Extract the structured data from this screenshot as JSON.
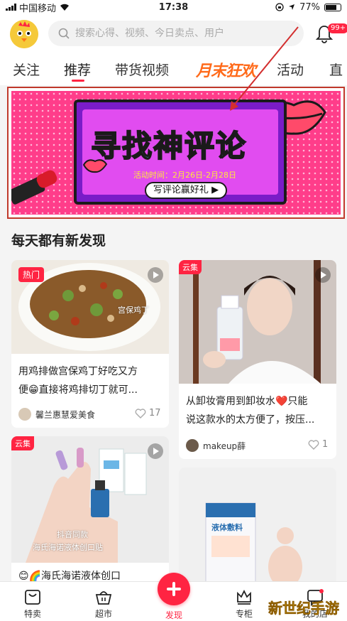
{
  "status_bar": {
    "carrier": "中国移动",
    "time": "17:38",
    "battery": "77%",
    "battery_level": 0.77
  },
  "header": {
    "search_placeholder": "搜索心得、视频、今日卖点、用户",
    "notification_badge": "99+"
  },
  "tabs": [
    {
      "label": "关注",
      "active": false
    },
    {
      "label": "推荐",
      "active": true
    },
    {
      "label": "带货视频",
      "active": false
    },
    {
      "label": "月末狂欢",
      "active": false,
      "style": "promo"
    },
    {
      "label": "活动",
      "active": false
    },
    {
      "label": "直",
      "active": false
    }
  ],
  "banner": {
    "title_part1": "寻找",
    "title_part2": "神",
    "title_part3": "评论",
    "time": "活动时间：2月26日-2月28日",
    "cta": "写评论赢好礼"
  },
  "section_title": "每天都有新发现",
  "cards": [
    {
      "tag": "热门",
      "image_caption": "宫保鸡丁",
      "text_line1": "用鸡排做宫保鸡丁好吃又方",
      "text_line2": "便😁直接将鸡排切丁就可...",
      "author": "馨兰惠慧爱美食",
      "likes": "17"
    },
    {
      "tag": "云集",
      "text_line1": "从卸妆膏用到卸妆水❤️只能",
      "text_line2": "说这款水的太方便了，按压...",
      "author": "makeup薛",
      "likes": "1"
    },
    {
      "tag": "云集",
      "image_caption_1": "抖音同款",
      "image_caption_2": "海氏海诺液体创口贴",
      "text_line1": "😊🌈海氏海诺液体创口"
    },
    {
      "image_caption": "液体敷料"
    }
  ],
  "bottom_nav": [
    {
      "label": "特卖"
    },
    {
      "label": "超市"
    },
    {
      "label": "发现"
    },
    {
      "label": "专柜"
    },
    {
      "label": "我的店"
    }
  ],
  "watermark": "新世纪手游",
  "colors": {
    "accent": "#ff2442",
    "promo": "#ff6a1a",
    "banner_bg": "#ff3d8a"
  }
}
